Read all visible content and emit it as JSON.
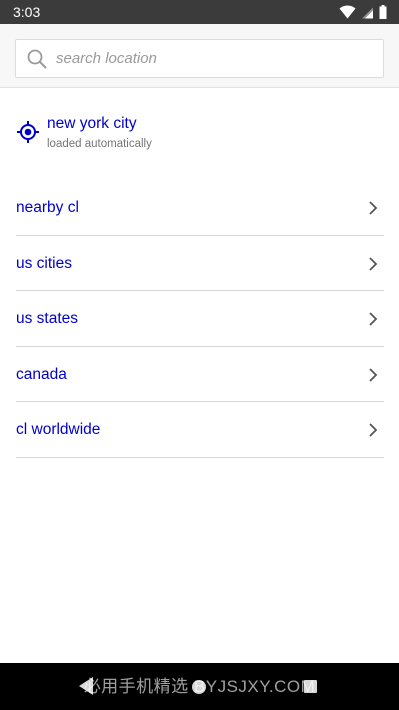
{
  "status_bar": {
    "time": "3:03",
    "background": "#3b3b3b",
    "icons": [
      "wifi-icon",
      "cell-signal-icon",
      "battery-icon"
    ]
  },
  "search": {
    "placeholder": "search location",
    "value": "",
    "icon": "search-icon"
  },
  "current_location": {
    "icon": "target-icon",
    "name": "new york city",
    "subtitle": "loaded automatically"
  },
  "nav": {
    "items": [
      {
        "label": "nearby cl",
        "icon": "chevron-right-icon"
      },
      {
        "label": "us cities",
        "icon": "chevron-right-icon"
      },
      {
        "label": "us states",
        "icon": "chevron-right-icon"
      },
      {
        "label": "canada",
        "icon": "chevron-right-icon"
      },
      {
        "label": "cl worldwide",
        "icon": "chevron-right-icon"
      }
    ]
  },
  "system_nav": {
    "icons": [
      "back-icon",
      "home-icon",
      "recents-icon"
    ],
    "watermark": "必用手机精选 BYJSJXY.COM"
  },
  "colors": {
    "link": "#0000cc",
    "divider": "#d6d6d6",
    "secondary_text": "#767676"
  }
}
